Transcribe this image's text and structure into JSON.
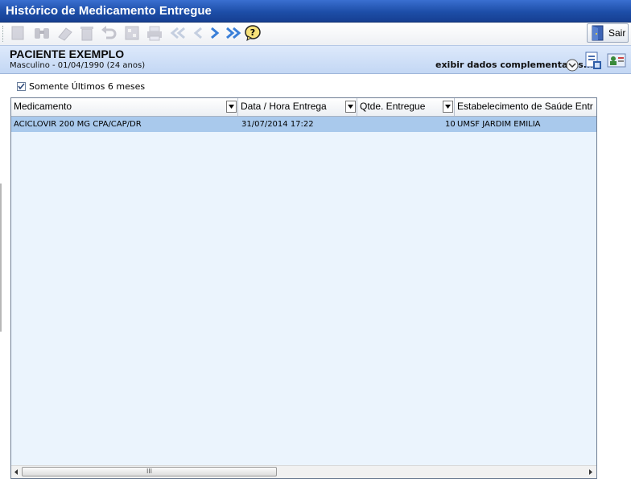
{
  "window": {
    "title": "Histórico de Medicamento Entregue"
  },
  "toolbar": {
    "buttons": [
      {
        "icon": "new-icon",
        "enabled": false
      },
      {
        "icon": "binoculars-icon",
        "enabled": false
      },
      {
        "icon": "eraser-icon",
        "enabled": false
      },
      {
        "icon": "trash-icon",
        "enabled": false
      },
      {
        "icon": "undo-icon",
        "enabled": false
      },
      {
        "icon": "calculator-icon",
        "enabled": false
      },
      {
        "icon": "printer-icon",
        "enabled": false
      },
      {
        "icon": "first-icon",
        "enabled": false
      },
      {
        "icon": "previous-icon",
        "enabled": false
      },
      {
        "icon": "next-icon",
        "enabled": true
      },
      {
        "icon": "last-icon",
        "enabled": true
      },
      {
        "icon": "help-icon",
        "enabled": true
      }
    ],
    "exit_label": "Sair"
  },
  "patient": {
    "name": "PACIENTE EXEMPLO",
    "info": "Masculino - 01/04/1990 (24 anos)",
    "extra_label": "exibir dados complementares..."
  },
  "filter": {
    "label": "Somente Últimos 6 meses",
    "checked": true
  },
  "grid": {
    "columns": [
      "Medicamento",
      "Data / Hora Entrega",
      "Qtde. Entregue",
      "Estabelecimento de Saúde Entr"
    ],
    "rows": [
      {
        "medicamento": "ACICLOVIR 200 MG CPA/CAP/DR",
        "data_hora": "31/07/2014 17:22",
        "qtde": "10",
        "estabelecimento": "UMSF JARDIM EMILIA"
      }
    ]
  },
  "scrollbar": {
    "thumb_glyph": "III"
  },
  "colors": {
    "title_bar": "#1d4ea8",
    "selected_row": "#a9c9ec",
    "grid_background": "#ebf4fd"
  }
}
